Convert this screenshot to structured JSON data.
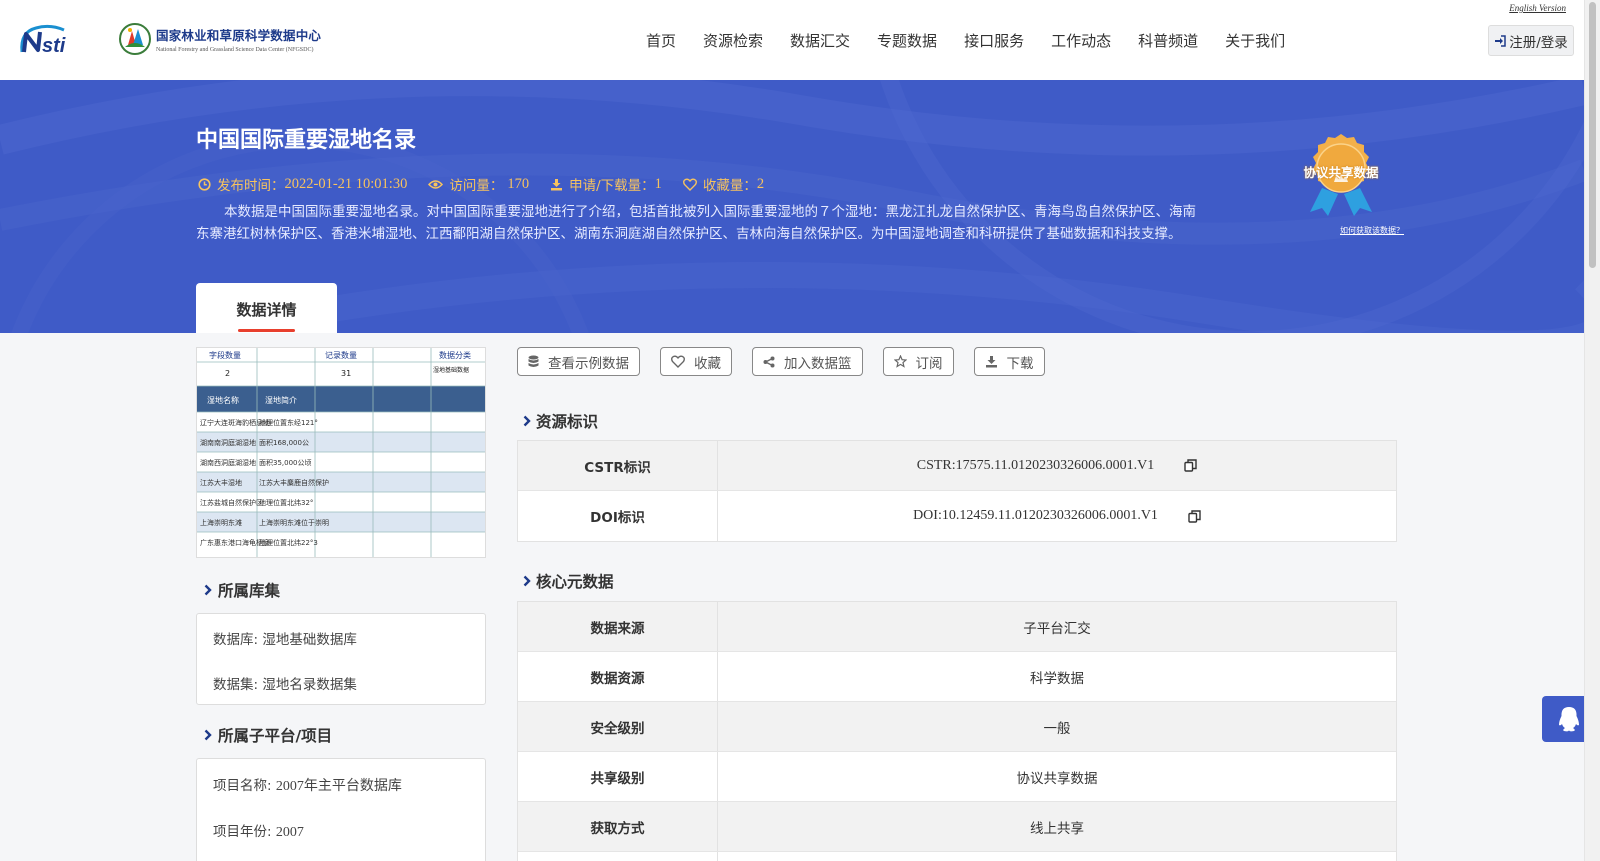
{
  "header": {
    "logo_nsti": "Nsti",
    "org_name_cn": "国家林业和草原科学数据中心",
    "org_name_en": "National Forestry and Grassland Science Data Center (NFGSDC)",
    "english_version": "English Version",
    "nav": [
      "首页",
      "资源检索",
      "数据汇交",
      "专题数据",
      "接口服务",
      "工作动态",
      "科普频道",
      "关于我们"
    ],
    "login": "注册/登录"
  },
  "banner": {
    "title": "中国国际重要湿地名录",
    "publish_label": "发布时间：",
    "publish_time": "2022-01-21 10:01:30",
    "visits_label": "访问量：",
    "visits": "170",
    "downloads_label": "申请/下载量：",
    "downloads": "1",
    "favorites_label": "收藏量：",
    "favorites": "2",
    "description": "本数据是中国国际重要湿地名录。对中国国际重要湿地进行了介绍，包括首批被列入国际重要湿地的７个湿地：黑龙江扎龙自然保护区、青海鸟岛自然保护区、海南东寨港红树林保护区、香港米埔湿地、江西鄱阳湖自然保护区、湖南东洞庭湖自然保护区、吉林向海自然保护区。为中国湿地调查和科研提供了基础数据和科技支撑。",
    "badge_text": "协议共享数据",
    "badge_link": "如何获取该数据？",
    "tab": "数据详情"
  },
  "preview": {
    "header_labels": [
      "字段数量",
      "记录数量",
      "数据分类"
    ],
    "header_values": [
      "2",
      "31",
      "湿地基础数据"
    ],
    "columns": [
      "湿地名称",
      "湿地简介"
    ],
    "rows": [
      [
        "辽宁大连斑海豹栖息地",
        "地理位置东经121°"
      ],
      [
        "湖南南洞庭湖湿地",
        "面积168,000公"
      ],
      [
        "湖南西洞庭湖湿地",
        "面积35,000公顷"
      ],
      [
        "江苏大丰湿地",
        "江苏大丰麋鹿自然保护"
      ],
      [
        "江苏盐城自然保护区",
        "地理位置北纬32°"
      ],
      [
        "上海崇明东滩",
        "上海崇明东滩位于崇明"
      ],
      [
        "广东惠东港口海龟栖息",
        "地理位置北纬22°3"
      ]
    ]
  },
  "library": {
    "title": "所属库集",
    "database_label": "数据库: ",
    "database": "湿地基础数据库",
    "dataset_label": "数据集: ",
    "dataset": "湿地名录数据集"
  },
  "subplatform": {
    "title": "所属子平台/项目",
    "project_name_label": "项目名称: ",
    "project_name": "2007年主平台数据库",
    "project_year_label": "项目年份: ",
    "project_year": "2007"
  },
  "actions": [
    "查看示例数据",
    "收藏",
    "加入数据篮",
    "订阅",
    "下载"
  ],
  "resource_id": {
    "title": "资源标识",
    "rows": [
      {
        "key": "CSTR标识",
        "value": "CSTR:17575.11.0120230326006.0001.V1"
      },
      {
        "key": "DOI标识",
        "value": "DOI:10.12459.11.0120230326006.0001.V1"
      }
    ]
  },
  "core_metadata": {
    "title": "核心元数据",
    "rows": [
      {
        "key": "数据来源",
        "value": "子平台汇交"
      },
      {
        "key": "数据资源",
        "value": "科学数据"
      },
      {
        "key": "安全级别",
        "value": "一般"
      },
      {
        "key": "共享级别",
        "value": "协议共享数据"
      },
      {
        "key": "获取方式",
        "value": "线上共享"
      }
    ]
  },
  "colors": {
    "brand_blue": "#3f5bc7",
    "meta_gold": "#f7c35f",
    "tab_underline": "#e83f2d"
  }
}
